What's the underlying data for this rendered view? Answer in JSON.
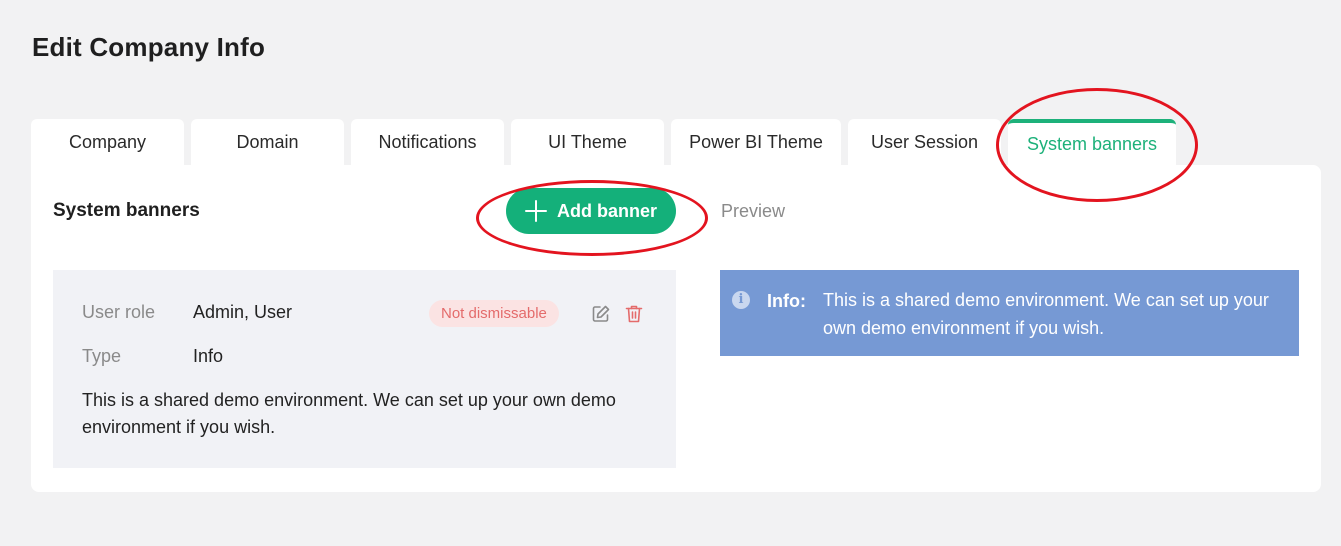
{
  "page": {
    "title": "Edit Company Info"
  },
  "tabs": [
    {
      "label": "Company"
    },
    {
      "label": "Domain"
    },
    {
      "label": "Notifications"
    },
    {
      "label": "UI Theme"
    },
    {
      "label": "Power BI Theme"
    },
    {
      "label": "User Session"
    },
    {
      "label": "System banners",
      "active": true
    }
  ],
  "section": {
    "title": "System banners",
    "add_button_label": "Add banner",
    "preview_label": "Preview"
  },
  "banner": {
    "user_role_label": "User role",
    "user_role_value": "Admin, User",
    "type_label": "Type",
    "type_value": "Info",
    "dismiss_badge": "Not dismissable",
    "message": "This is a shared demo environment. We can set up your own demo environment if you wish."
  },
  "preview": {
    "icon": "info-icon",
    "label": "Info:",
    "message": "This is a shared demo environment. We can set up your own demo environment if you wish."
  },
  "colors": {
    "accent": "#14b07a",
    "badge_bg": "#fbe3e3",
    "badge_text": "#e46b6b",
    "preview_bg": "#7699d4",
    "annotation": "#e3141f"
  },
  "icons": {
    "edit": "edit-icon",
    "delete": "trash-icon",
    "add": "plus-icon"
  }
}
